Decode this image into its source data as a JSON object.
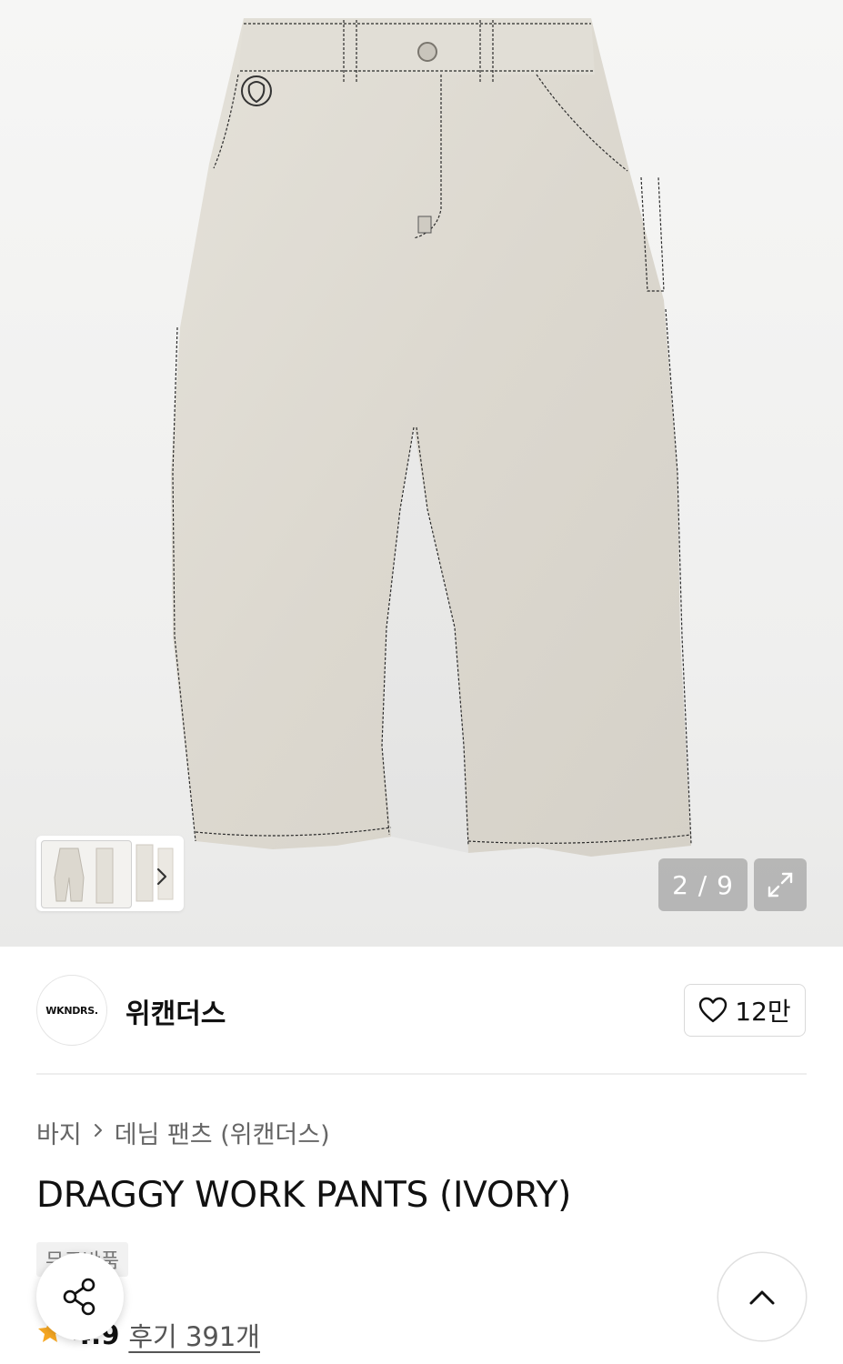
{
  "gallery": {
    "counter": "2 / 9",
    "icons": {
      "expand": "expand-icon",
      "next": "chevron-right-icon"
    }
  },
  "brand": {
    "logo_text": "WKNDRS.",
    "name": "위캔더스",
    "like_count": "12만"
  },
  "breadcrumb": {
    "items": [
      "바지",
      "데님 팬츠 (위캔더스)"
    ]
  },
  "product": {
    "title": "DRAGGY WORK PANTS (IVORY)",
    "badge": "무료반품",
    "rating": "4.9",
    "review_text": "후기 391개"
  },
  "colors": {
    "accent_star": "#f7a823",
    "pants": "#dcd8cf"
  }
}
